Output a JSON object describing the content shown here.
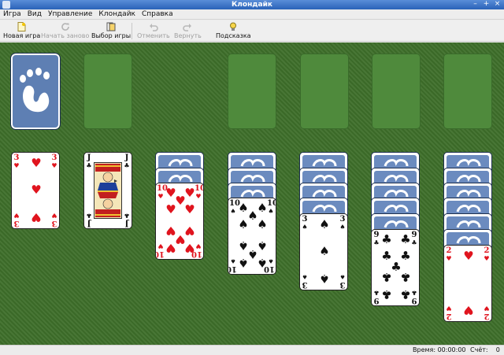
{
  "window": {
    "title": "Клондайк"
  },
  "menu": [
    "Игра",
    "Вид",
    "Управление",
    "Клондайк",
    "Справка"
  ],
  "toolbar": {
    "new_game": "Новая игра",
    "restart": "Начать заново",
    "select_game": "Выбор игры",
    "undo": "Отменить",
    "redo": "Вернуть",
    "hint": "Подсказка"
  },
  "cards": {
    "col1": {
      "rank": "3",
      "suit": "♥"
    },
    "col2": {
      "rank": "J",
      "suit": "♣"
    },
    "col3": {
      "rank": "10",
      "suit": "♥"
    },
    "col4": {
      "rank": "10",
      "suit": "♠"
    },
    "col5": {
      "rank": "3",
      "suit": "♠"
    },
    "col6": {
      "rank": "9",
      "suit": "♣"
    },
    "col7": {
      "rank": "2",
      "suit": "♥"
    }
  },
  "status": {
    "time_label": "Время: 00:00:00",
    "score_label": "Счёт:",
    "score_value": "0"
  },
  "colors": {
    "felt": "#3e6f2a",
    "card_back": "#6b8bbf",
    "red_suit": "#e0141e"
  }
}
